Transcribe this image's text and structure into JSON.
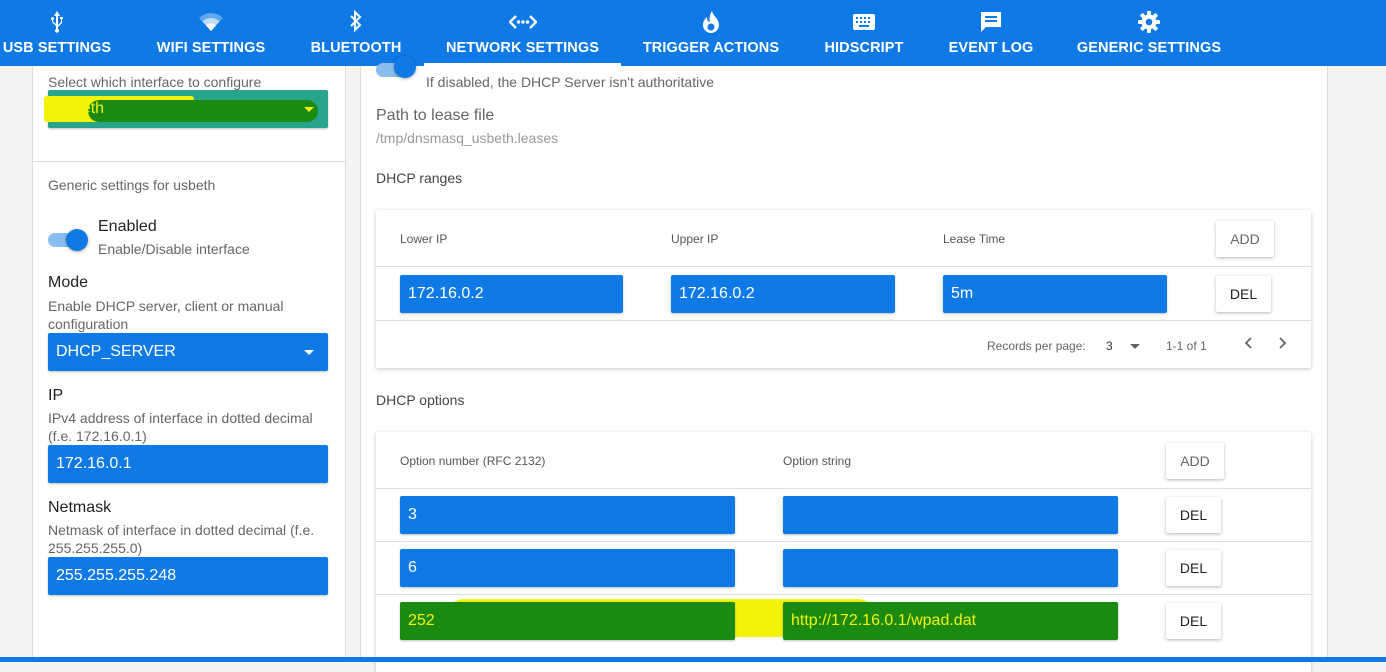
{
  "nav": {
    "tabs": [
      {
        "label": "USB SETTINGS",
        "icon": "usb-icon"
      },
      {
        "label": "WIFI SETTINGS",
        "icon": "wifi-icon"
      },
      {
        "label": "BLUETOOTH",
        "icon": "bluetooth-icon"
      },
      {
        "label": "NETWORK SETTINGS",
        "icon": "network-icon",
        "active": true
      },
      {
        "label": "TRIGGER ACTIONS",
        "icon": "flame-icon"
      },
      {
        "label": "HIDSCRIPT",
        "icon": "keyboard-icon"
      },
      {
        "label": "EVENT LOG",
        "icon": "message-icon"
      },
      {
        "label": "GENERIC SETTINGS",
        "icon": "gear-icon"
      }
    ]
  },
  "left": {
    "interface_prompt": "Select which interface to configure",
    "interface_value": "usbeth",
    "generic_title": "Generic settings for usbeth",
    "enabled": {
      "title": "Enabled",
      "sub": "Enable/Disable interface",
      "on": true
    },
    "mode": {
      "title": "Mode",
      "sub": "Enable DHCP server, client or manual configuration",
      "value": "DHCP_SERVER"
    },
    "ip": {
      "title": "IP",
      "sub": "IPv4 address of interface in dotted decimal (f.e. 172.16.0.1)",
      "value": "172.16.0.1"
    },
    "netmask": {
      "title": "Netmask",
      "sub": "Netmask of interface in dotted decimal (f.e. 255.255.255.0)",
      "value": "255.255.255.248"
    }
  },
  "right": {
    "authoritative_hint": "If disabled, the DHCP Server isn't authoritative",
    "lease_path_title": "Path to lease file",
    "lease_path_value": "/tmp/dnsmasq_usbeth.leases",
    "ranges_title": "DHCP ranges",
    "ranges": {
      "headers": [
        "Lower IP",
        "Upper IP",
        "Lease Time"
      ],
      "add_label": "ADD",
      "rows": [
        {
          "lower": "172.16.0.2",
          "upper": "172.16.0.2",
          "lease": "5m",
          "del_label": "DEL"
        }
      ],
      "records_label": "Records per page:",
      "records_value": "3",
      "range_text": "1-1 of 1"
    },
    "options_title": "DHCP options",
    "options": {
      "headers": [
        "Option number (RFC 2132)",
        "Option string"
      ],
      "add_label": "ADD",
      "rows": [
        {
          "number": "3",
          "string": "",
          "del_label": "DEL"
        },
        {
          "number": "6",
          "string": "",
          "del_label": "DEL"
        },
        {
          "number": "252",
          "string": "http://172.16.0.1/wpad.dat",
          "del_label": "DEL"
        }
      ]
    }
  },
  "colors": {
    "primary": "#0f7ae5",
    "highlight_yellow": "#f2f20a",
    "scribble_green": "#1a8a10"
  }
}
